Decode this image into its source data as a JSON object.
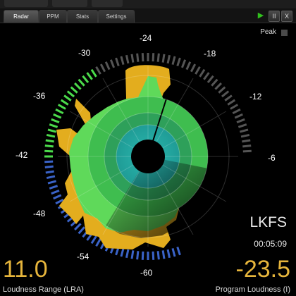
{
  "tabs": [
    {
      "label": "Radar",
      "active": true
    },
    {
      "label": "PPM",
      "active": false
    },
    {
      "label": "Stats",
      "active": false
    },
    {
      "label": "Settings",
      "active": false
    }
  ],
  "controls": {
    "play_icon": "play-icon",
    "pause_label": "II",
    "close_label": "X"
  },
  "peak": {
    "label": "Peak"
  },
  "scale_labels": [
    "-24",
    "-18",
    "-12",
    "-6",
    "-60",
    "-54",
    "-48",
    "-42",
    "-36",
    "-30"
  ],
  "unit": "LKFS",
  "elapsed": "00:05:09",
  "loudness_range": {
    "value": "11.0",
    "label": "Loudness Range (LRA)"
  },
  "program_loudness": {
    "value": "-23.5",
    "label": "Program Loudness (I)"
  },
  "colors": {
    "accent": "#e6b53c",
    "ring_green": "#4bdb4b",
    "ring_blue": "#3a63c8",
    "ring_gray": "#555555"
  }
}
